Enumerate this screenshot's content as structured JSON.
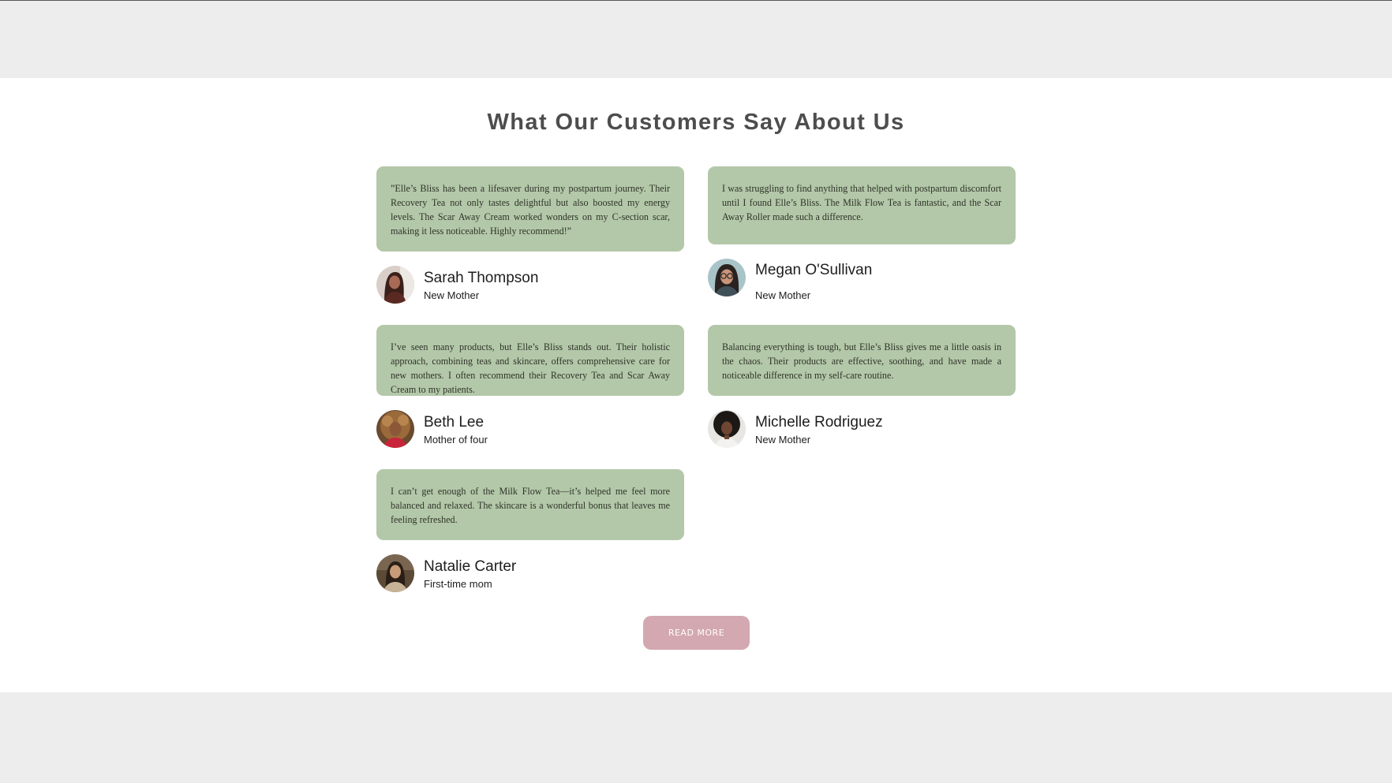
{
  "section": {
    "title": "What Our Customers Say About Us",
    "read_more_label": "READ MORE"
  },
  "testimonials": [
    {
      "quote": "”Elle’s Bliss has been a lifesaver during my postpartum journey. Their Recovery Tea not only tastes delightful but also boosted my energy levels. The Scar Away Cream worked wonders on my C-section scar, making it less noticeable. Highly recommend!”",
      "name": "Sarah Thompson",
      "role": "New Mother"
    },
    {
      "quote": "I was struggling to find anything that helped with postpartum discomfort until I found Elle’s Bliss. The Milk Flow Tea is fantastic, and the Scar Away Roller made such a difference.",
      "name": "Megan O'Sullivan",
      "role": "New Mother"
    },
    {
      "quote": "I’ve seen many products, but Elle’s Bliss stands out. Their holistic approach, combining teas and skincare, offers comprehensive care for new mothers. I often recommend their Recovery Tea and Scar Away Cream to my patients.",
      "name": "Beth Lee",
      "role": "Mother of four"
    },
    {
      "quote": "Balancing everything is tough, but Elle’s Bliss gives me a little oasis in the chaos. Their products are effective, soothing, and have made a noticeable difference in my self-care routine.",
      "name": "Michelle Rodriguez",
      "role": "New Mother"
    },
    {
      "quote": "I can’t get enough of the Milk Flow Tea—it’s helped me feel more balanced and relaxed. The skincare is a wonderful bonus that leaves me feeling refreshed.",
      "name": "Natalie Carter",
      "role": "First-time mom"
    }
  ],
  "colors": {
    "card_background": "#b3c8a9",
    "button_background": "#d3a8b0",
    "page_band": "#ededed",
    "title_text": "#4d4d4d"
  }
}
